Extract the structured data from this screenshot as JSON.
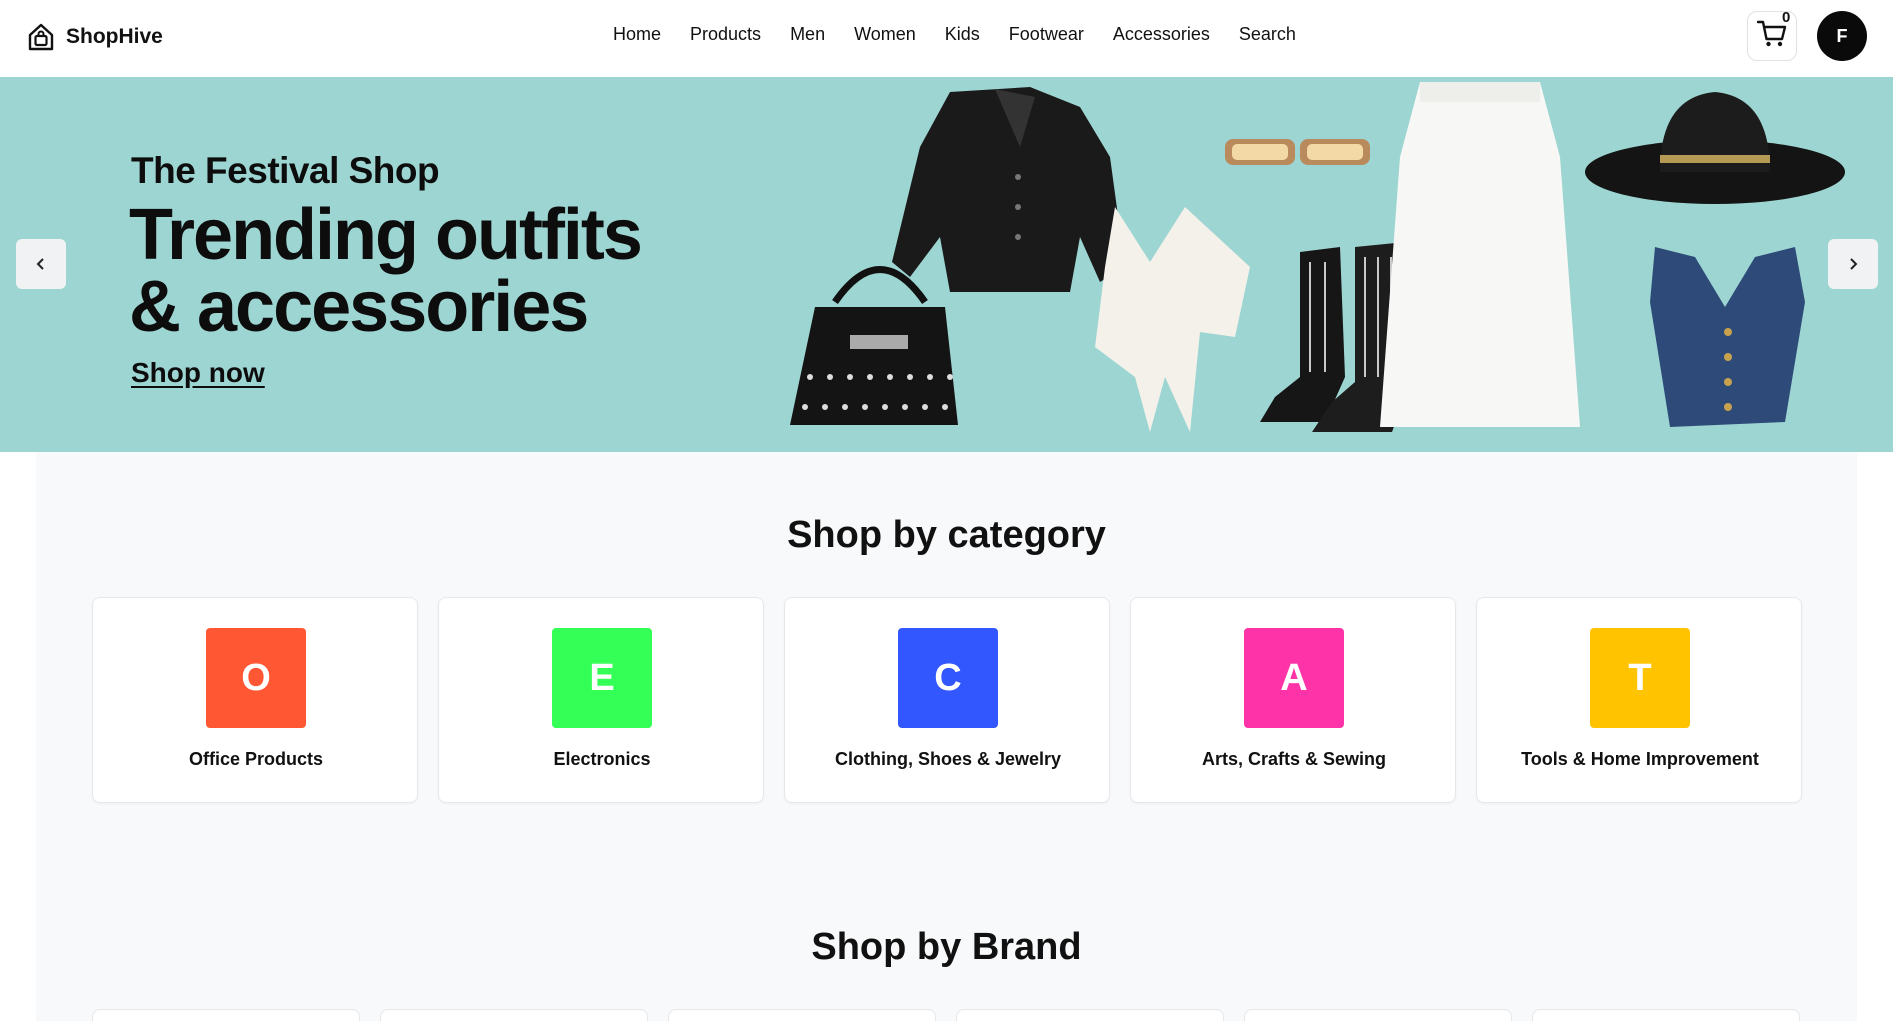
{
  "header": {
    "brand_name": "ShopHive",
    "brand_icon": "shopping-bag-home-icon",
    "nav": [
      "Home",
      "Products",
      "Men",
      "Women",
      "Kids",
      "Footwear",
      "Accessories",
      "Search"
    ],
    "cart_count": "0",
    "cart_icon": "cart-icon",
    "avatar_initial": "F"
  },
  "hero": {
    "eyebrow": "The Festival Shop",
    "title_line1": "Trending outfits",
    "title_line2": "& accessories",
    "cta": "Shop now",
    "background": "#9dd5d2",
    "prev_icon": "chevron-left-icon",
    "next_icon": "chevron-right-icon"
  },
  "categories": {
    "title": "Shop by category",
    "items": [
      {
        "letter": "O",
        "label": "Office Products",
        "color": "#ff5733"
      },
      {
        "letter": "E",
        "label": "Electronics",
        "color": "#33ff57"
      },
      {
        "letter": "C",
        "label": "Clothing, Shoes & Jewelry",
        "color": "#3357ff"
      },
      {
        "letter": "A",
        "label": "Arts, Crafts & Sewing",
        "color": "#ff33a8"
      },
      {
        "letter": "T",
        "label": "Tools & Home Improvement",
        "color": "#ffc300"
      }
    ]
  },
  "brands": {
    "title": "Shop by Brand"
  }
}
